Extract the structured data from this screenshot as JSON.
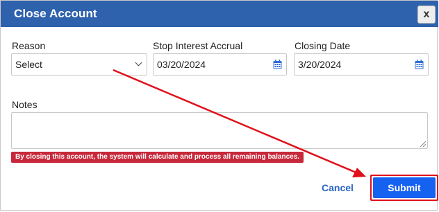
{
  "dialog": {
    "title": "Close Account",
    "close_label": "x"
  },
  "form": {
    "reason": {
      "label": "Reason",
      "value": "Select"
    },
    "stop_interest_accrual": {
      "label": "Stop Interest Accrual",
      "value": "03/20/2024"
    },
    "closing_date": {
      "label": "Closing Date",
      "value": "3/20/2024"
    },
    "notes": {
      "label": "Notes",
      "value": ""
    },
    "warning": "By closing this account, the system will calculate and process all remaining balances."
  },
  "actions": {
    "cancel_label": "Cancel",
    "submit_label": "Submit"
  },
  "colors": {
    "titlebar": "#2f62ad",
    "warning_bg": "#c7283a",
    "submit_bg": "#1561f0",
    "annotation": "#e0101a"
  },
  "icons": [
    "close-icon",
    "chevron-down-icon",
    "calendar-icon",
    "resize-handle-icon",
    "annotation-arrow"
  ]
}
